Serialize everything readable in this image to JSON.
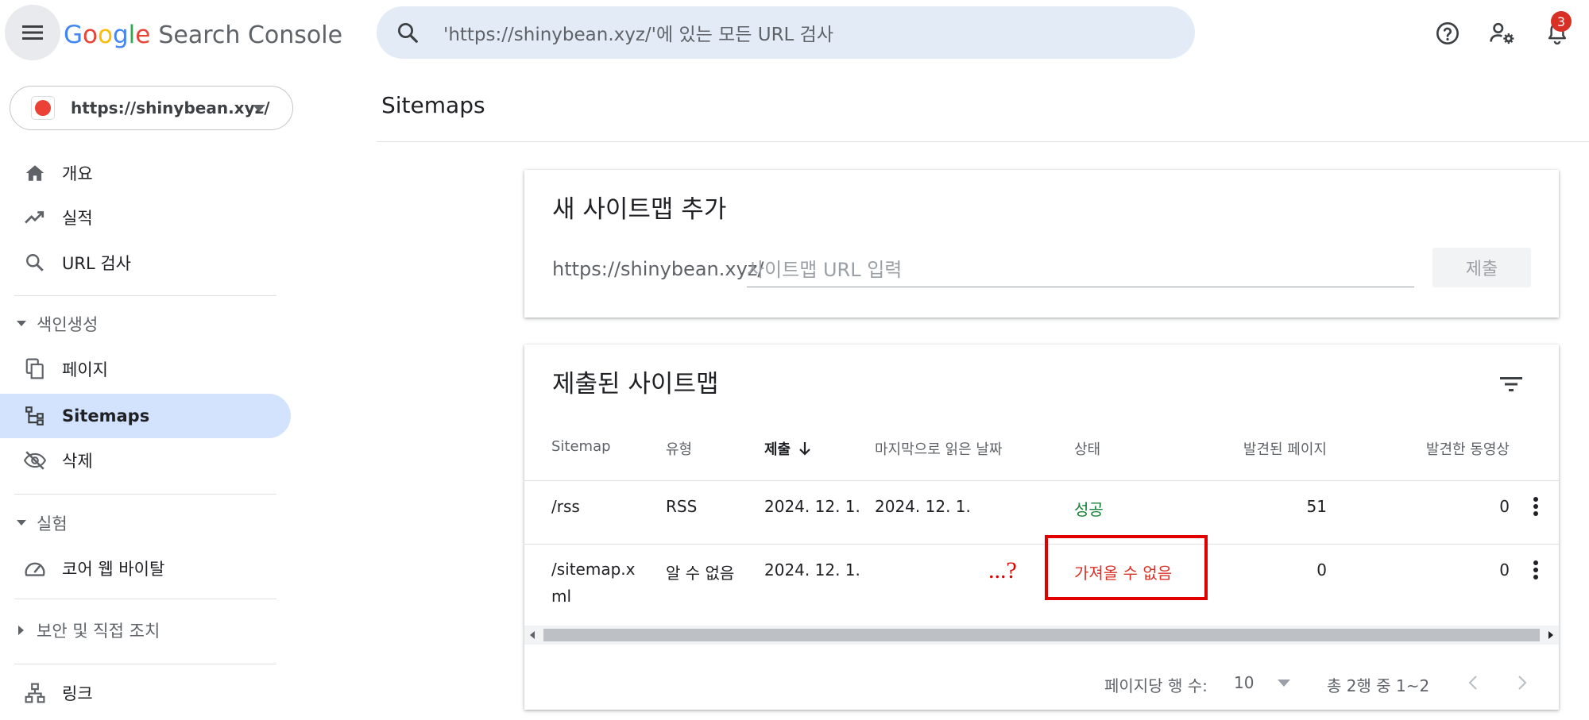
{
  "app": {
    "logo_google": [
      "G",
      "o",
      "o",
      "g",
      "l",
      "e"
    ],
    "product": "Search Console",
    "search_placeholder": "'https://shinybean.xyz/'에 있는 모든 URL 검사",
    "notification_count": "3"
  },
  "property": {
    "url": "https://shinybean.xyz/"
  },
  "sidebar": {
    "overview": "개요",
    "performance": "실적",
    "url_inspection": "URL 검사",
    "indexing_section": "색인생성",
    "pages": "페이지",
    "sitemaps": "Sitemaps",
    "removals": "삭제",
    "experience_section": "실험",
    "core_web_vitals": "코어 웹 바이탈",
    "security_section": "보안 및 직접 조치",
    "links": "링크"
  },
  "main": {
    "title": "Sitemaps",
    "add_card": {
      "title": "새 사이트맵 추가",
      "prefix": "https://shinybean.xyz/",
      "input_placeholder": "사이트맵 URL 입력",
      "input_value": "",
      "submit_label": "제출"
    },
    "list_card": {
      "title": "제출된 사이트맵",
      "columns": {
        "sitemap": "Sitemap",
        "type": "유형",
        "submitted": "제출",
        "last_read": "마지막으로 읽은 날짜",
        "status": "상태",
        "discovered_pages": "발견된 페이지",
        "discovered_videos": "발견한 동영상"
      },
      "rows": [
        {
          "sitemap": "/rss",
          "type": "RSS",
          "submitted": "2024. 12. 1.",
          "last_read": "2024. 12. 1.",
          "status": "성공",
          "pages": "51",
          "videos": "0"
        },
        {
          "sitemap": "/sitemap.xml",
          "type": "알 수 없음",
          "submitted": "2024. 12. 1.",
          "last_read": "",
          "status": "가져올 수 없음",
          "pages": "0",
          "videos": "0"
        }
      ],
      "annotation": "...?",
      "pager": {
        "rows_per_page_label": "페이지당 행 수:",
        "rows_per_page": "10",
        "range": "총 2행 중 1~2"
      }
    }
  },
  "colors": {
    "accent_blue": "#1a73e8",
    "active_nav_bg": "#d3e3fd",
    "success": "#188038",
    "error": "#d93025",
    "annotation_red": "#e00000"
  },
  "icons": [
    "menu-icon",
    "search-icon",
    "help-icon",
    "manage-accounts-icon",
    "bell-icon",
    "home-icon",
    "trending-icon",
    "search-icon",
    "pages-icon",
    "sitemap-icon",
    "visibility-off-icon",
    "gauge-icon",
    "links-icon",
    "filter-icon",
    "arrow-down-icon",
    "more-vert-icon",
    "chevron-left-icon",
    "chevron-right-icon"
  ]
}
